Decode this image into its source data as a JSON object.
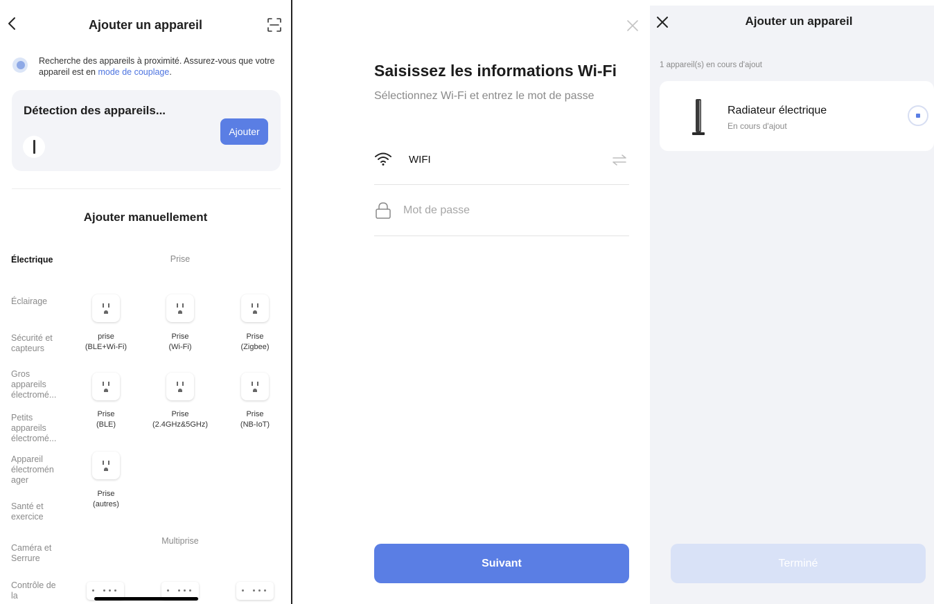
{
  "panel1": {
    "title": "Ajouter un appareil",
    "info_text": "Recherche des appareils à proximité. Assurez-vous que votre appareil est en ",
    "info_link": "mode de couplage",
    "info_end": ".",
    "detect_title": "Détection des appareils...",
    "add_label": "Ajouter",
    "manual_title": "Ajouter manuellement",
    "categories": [
      "Électrique",
      "Éclairage",
      "Sécurité et capteurs",
      "Gros appareils électromé...",
      "Petits appareils électromé...",
      "Appareil électromén ager",
      "Santé et exercice",
      "Caméra et Serrure",
      "Contrôle de la"
    ],
    "section_prise": "Prise",
    "section_multiprise": "Multiprise",
    "products": [
      {
        "line1": "prise",
        "line2": "(BLE+Wi-Fi)"
      },
      {
        "line1": "Prise",
        "line2": "(Wi-Fi)"
      },
      {
        "line1": "Prise",
        "line2": "(Zigbee)"
      },
      {
        "line1": "Prise",
        "line2": "(BLE)"
      },
      {
        "line1": "Prise",
        "line2": "(2.4GHz&5GHz)"
      },
      {
        "line1": "Prise",
        "line2": "(NB-IoT)"
      },
      {
        "line1": "Prise",
        "line2": "(autres)"
      }
    ]
  },
  "panel2": {
    "title": "Saisissez les informations Wi-Fi",
    "subtitle": "Sélectionnez Wi-Fi et entrez le mot de passe",
    "wifi_name": "WIFI",
    "password_placeholder": "Mot de passe",
    "next_label": "Suivant"
  },
  "panel3": {
    "title": "Ajouter un appareil",
    "count_text": "1 appareil(s) en cours d'ajout",
    "device_name": "Radiateur électrique",
    "device_status": "En cours d'ajout",
    "done_label": "Terminé"
  }
}
